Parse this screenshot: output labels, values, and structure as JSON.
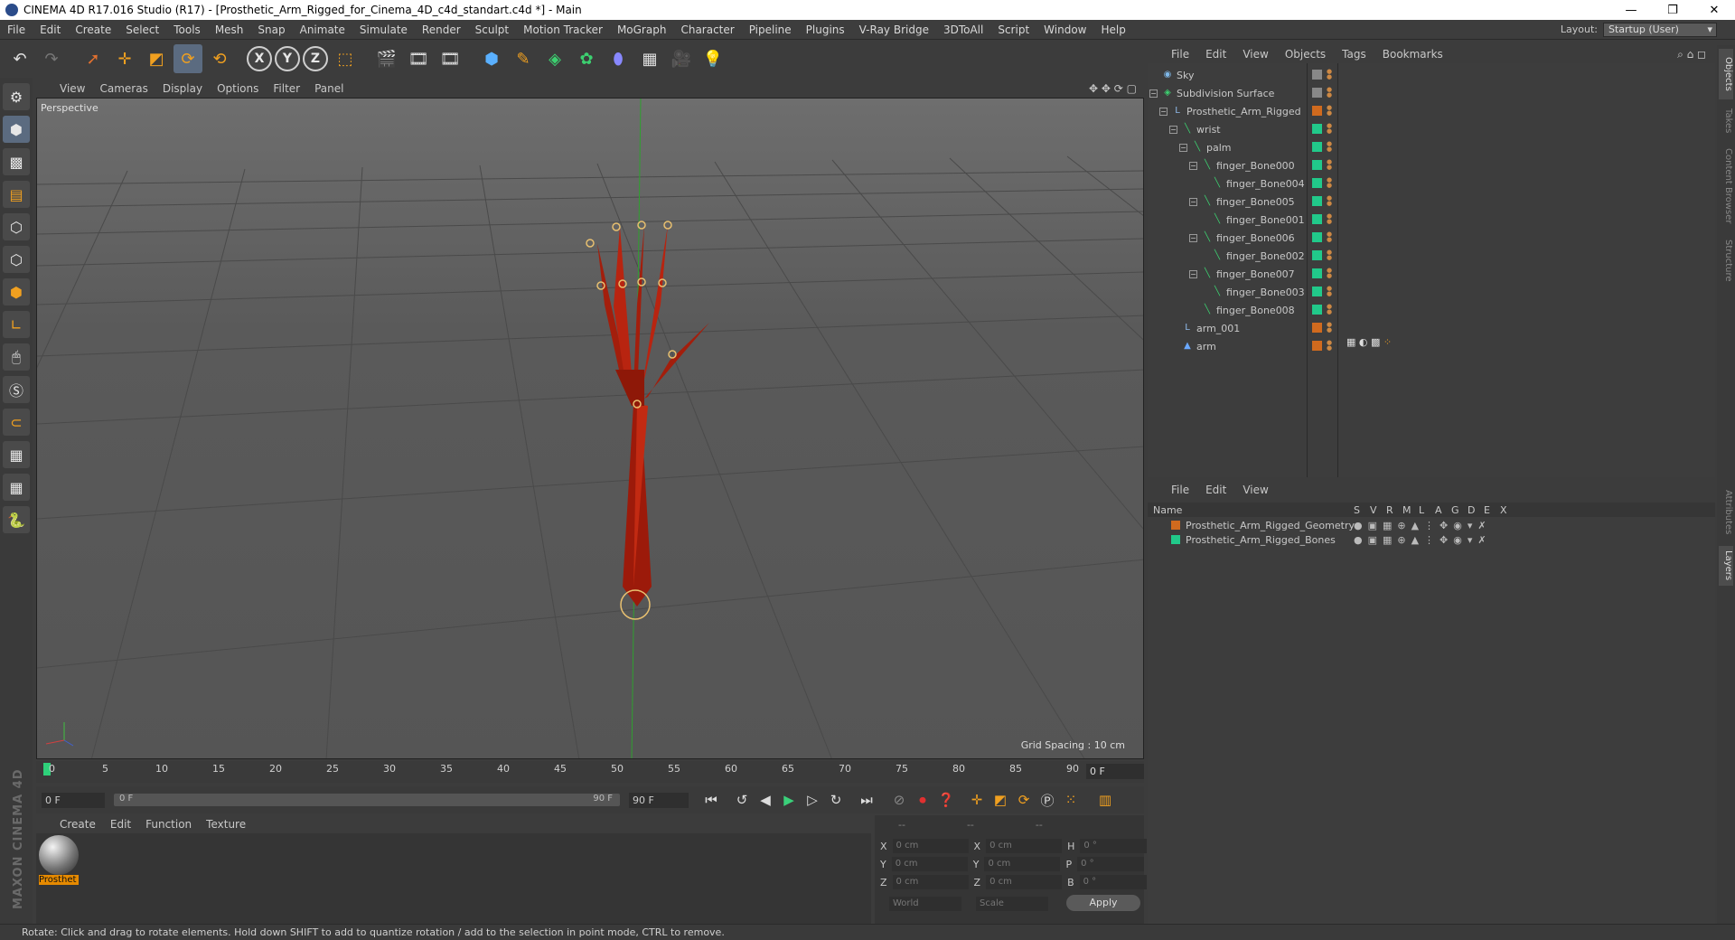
{
  "window": {
    "title": "CINEMA 4D R17.016 Studio (R17) - [Prosthetic_Arm_Rigged_for_Cinema_4D_c4d_standart.c4d *] - Main",
    "minimize": "—",
    "maximize": "❐",
    "close": "✕"
  },
  "menubar": {
    "items": [
      "File",
      "Edit",
      "Create",
      "Select",
      "Tools",
      "Mesh",
      "Snap",
      "Animate",
      "Simulate",
      "Render",
      "Sculpt",
      "Motion Tracker",
      "MoGraph",
      "Character",
      "Pipeline",
      "Plugins",
      "V-Ray Bridge",
      "3DToAll",
      "Script",
      "Window",
      "Help"
    ],
    "layout_label": "Layout:",
    "layout_value": "Startup (User)"
  },
  "toolbar": {
    "axis_labels": [
      "X",
      "Y",
      "Z"
    ]
  },
  "viewport": {
    "menu": [
      "View",
      "Cameras",
      "Display",
      "Options",
      "Filter",
      "Panel"
    ],
    "label": "Perspective",
    "grid_spacing": "Grid Spacing : 10 cm"
  },
  "timeline": {
    "ticks": [
      "0",
      "5",
      "10",
      "15",
      "20",
      "25",
      "30",
      "35",
      "40",
      "45",
      "50",
      "55",
      "60",
      "65",
      "70",
      "75",
      "80",
      "85",
      "90"
    ],
    "current_frame": "0 F",
    "start": "0 F",
    "range_start": "0 F",
    "range_end": "90 F",
    "end": "90 F"
  },
  "material_manager": {
    "menu": [
      "Create",
      "Edit",
      "Function",
      "Texture"
    ],
    "material_name": "Prosthet"
  },
  "coordinates": {
    "headers": [
      "--",
      "--",
      "--"
    ],
    "rows": [
      {
        "a": "X",
        "av": "0 cm",
        "b": "X",
        "bv": "0 cm",
        "c": "H",
        "cv": "0 °"
      },
      {
        "a": "Y",
        "av": "0 cm",
        "b": "Y",
        "bv": "0 cm",
        "c": "P",
        "cv": "0 °"
      },
      {
        "a": "Z",
        "av": "0 cm",
        "b": "Z",
        "bv": "0 cm",
        "c": "B",
        "cv": "0 °"
      }
    ],
    "world": "World",
    "scale": "Scale",
    "apply": "Apply"
  },
  "object_manager": {
    "menu": [
      "File",
      "Edit",
      "View",
      "Objects",
      "Tags",
      "Bookmarks"
    ],
    "objects": [
      {
        "name": "Sky",
        "depth": 0,
        "icon": "sky-icon",
        "color": "#888888"
      },
      {
        "name": "Subdivision Surface",
        "depth": 0,
        "icon": "subdivision-icon",
        "color": "#888888"
      },
      {
        "name": "Prosthetic_Arm_Rigged",
        "depth": 1,
        "icon": "null-icon",
        "color": "#d06a1e"
      },
      {
        "name": "wrist",
        "depth": 2,
        "icon": "bone-icon",
        "color": "#21c98a"
      },
      {
        "name": "palm",
        "depth": 3,
        "icon": "bone-icon",
        "color": "#21c98a"
      },
      {
        "name": "finger_Bone000",
        "depth": 4,
        "icon": "bone-icon",
        "color": "#21c98a"
      },
      {
        "name": "finger_Bone004",
        "depth": 5,
        "icon": "bone-icon",
        "color": "#21c98a"
      },
      {
        "name": "finger_Bone005",
        "depth": 4,
        "icon": "bone-icon",
        "color": "#21c98a"
      },
      {
        "name": "finger_Bone001",
        "depth": 5,
        "icon": "bone-icon",
        "color": "#21c98a"
      },
      {
        "name": "finger_Bone006",
        "depth": 4,
        "icon": "bone-icon",
        "color": "#21c98a"
      },
      {
        "name": "finger_Bone002",
        "depth": 5,
        "icon": "bone-icon",
        "color": "#21c98a"
      },
      {
        "name": "finger_Bone007",
        "depth": 4,
        "icon": "bone-icon",
        "color": "#21c98a"
      },
      {
        "name": "finger_Bone003",
        "depth": 5,
        "icon": "bone-icon",
        "color": "#21c98a"
      },
      {
        "name": "finger_Bone008",
        "depth": 4,
        "icon": "bone-icon",
        "color": "#21c98a"
      },
      {
        "name": "arm_001",
        "depth": 2,
        "icon": "null-icon",
        "color": "#d06a1e"
      },
      {
        "name": "arm",
        "depth": 2,
        "icon": "polygon-icon",
        "color": "#d06a1e"
      }
    ]
  },
  "layer_manager": {
    "menu": [
      "File",
      "Edit",
      "View"
    ],
    "columns": [
      "Name",
      "S",
      "V",
      "R",
      "M",
      "L",
      "A",
      "G",
      "D",
      "E",
      "X"
    ],
    "layers": [
      {
        "name": "Prosthetic_Arm_Rigged_Geometry",
        "color": "#d06a1e"
      },
      {
        "name": "Prosthetic_Arm_Rigged_Bones",
        "color": "#21c98a"
      }
    ]
  },
  "side_tabs": [
    "Objects",
    "Takes",
    "Content Browser",
    "Structure",
    "Attributes",
    "Layers"
  ],
  "status": "Rotate: Click and drag to rotate elements. Hold down SHIFT to add to quantize rotation / add to the selection in point mode, CTRL to remove.",
  "branding": "MAXON CINEMA 4D"
}
